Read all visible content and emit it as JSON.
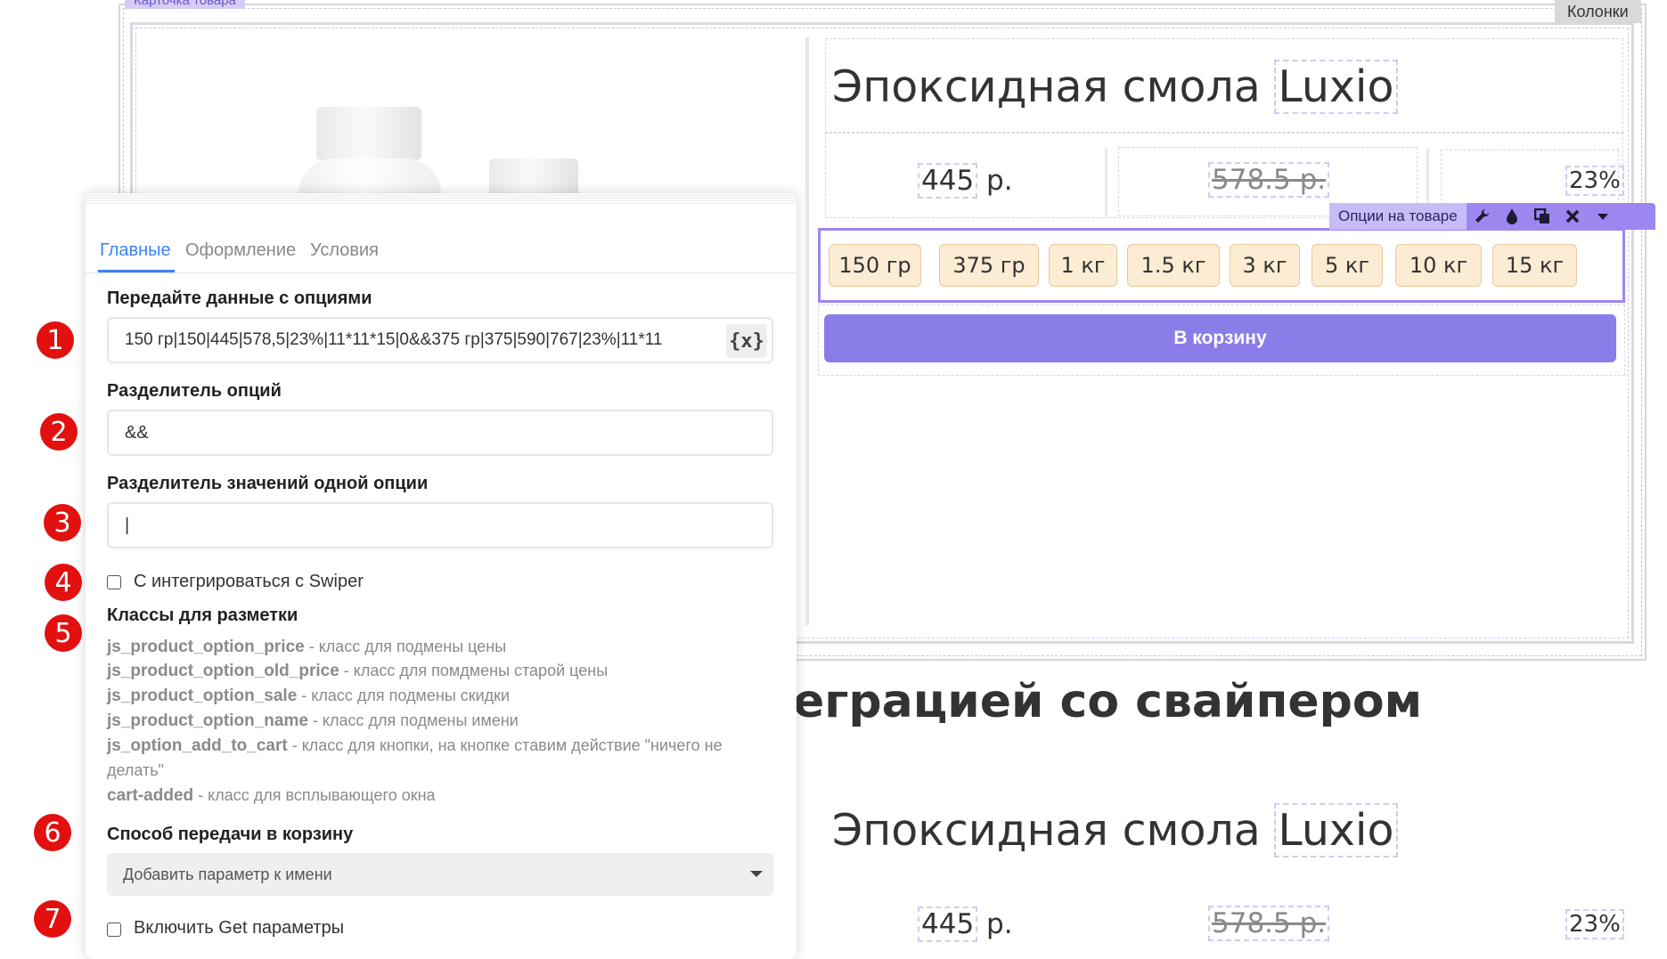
{
  "canvas": {
    "block_label": "Карточка товара",
    "columns_label": "Колонки"
  },
  "product_card": {
    "title_prefix": "Эпоксидная смола",
    "title_name": "Luxio",
    "price_value": "445",
    "price_unit": "р.",
    "old_price": "578.5 р.",
    "sale": "23%",
    "options_toolbar": {
      "label": "Опции на товаре",
      "icons": [
        "wrench-icon",
        "drop-icon",
        "copy-icon",
        "close-icon",
        "caret-down-icon"
      ]
    },
    "options": [
      "150 гр",
      "375 гр",
      "1 кг",
      "1.5 кг",
      "3 кг",
      "5 кг",
      "10 кг",
      "15 кг"
    ],
    "cart_button": "В корзину"
  },
  "section_heading": "еграцией со свайпером",
  "second_card": {
    "title_prefix": "Эпоксидная смола",
    "title_name": "Luxio",
    "price_value": "445",
    "price_unit": "р.",
    "old_price": "578.5 р.",
    "sale": "23%"
  },
  "settings_panel": {
    "tabs": [
      "Главные",
      "Оформление",
      "Условия"
    ],
    "active_tab": "Главные",
    "fields": {
      "options_data": {
        "label": "Передайте данные с опциями",
        "value": "150 гр|150|445|578,5|23%|11*11*15|0&&375 гр|375|590|767|23%|11*11",
        "variable_button": "{x}"
      },
      "options_separator": {
        "label": "Разделитель опций",
        "value": "&&"
      },
      "value_separator": {
        "label": "Разделитель значений одной опции",
        "value": "|"
      },
      "swiper_checkbox": {
        "label": "С интегрироваться с Swiper",
        "checked": false
      },
      "markup_classes": {
        "label": "Классы для разметки",
        "items": [
          {
            "cls": "js_product_option_price",
            "desc": " - класс для подмены цены"
          },
          {
            "cls": "js_product_option_old_price",
            "desc": " - класс для помдмены старой цены"
          },
          {
            "cls": "js_product_option_sale",
            "desc": " - класс для подмены скидки"
          },
          {
            "cls": "js_product_option_name",
            "desc": " - класс для подмены имени"
          },
          {
            "cls": "js_option_add_to_cart",
            "desc": " - класс для кнопки, на кнопке ставим действие \"ничего не"
          },
          {
            "cls": "",
            "desc": "делать\""
          },
          {
            "cls": "cart-added",
            "desc": " - класс для всплывающего окна"
          }
        ]
      },
      "cart_method": {
        "label": "Способ передачи в корзину",
        "selected": "Добавить параметр к имени"
      },
      "get_params_checkbox": {
        "label": "Включить Get параметры",
        "checked": false
      }
    }
  },
  "markers": [
    "1",
    "2",
    "3",
    "4",
    "5",
    "6",
    "7"
  ],
  "colors": {
    "accent_violet": "#9d86f0",
    "button_violet": "#8b7de8",
    "chip_bg": "#fcecd3",
    "marker_red": "#e31010",
    "tab_active": "#3b82f6"
  }
}
